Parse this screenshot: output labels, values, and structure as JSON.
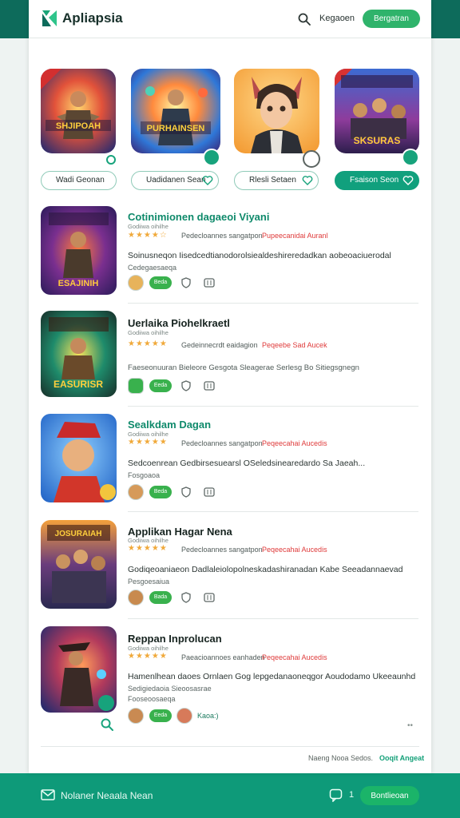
{
  "header": {
    "brand": "Apliapsia",
    "link": "Kegaoen",
    "cta": "Bergatran"
  },
  "featured": [
    {
      "title_art": "SHJIPOAH",
      "button": "Wadi Geonan",
      "active": false
    },
    {
      "title_art": "PURHAINSEN",
      "button": "Uadidanen Sean",
      "active": false
    },
    {
      "title_art": "",
      "button": "Rlesli Setaen",
      "active": false
    },
    {
      "title_art": "SKSURAS",
      "button": "Fsaison Seon",
      "active": true
    }
  ],
  "list": [
    {
      "title": "Cotinimionen dagaeoi Viyani",
      "title_color": "#0f8a6b",
      "subtitle": "Godiiwa oihilhe",
      "stars": "★★★★☆",
      "meta": "Pedecloannes sangatpon",
      "tag": "Pupeecanidai Auranl",
      "desc": "Soinusneqon Iisedcedtianodorolsiealdeshireredadkan aobeoaciuerodal",
      "desc2": "Cedegaesaeqa",
      "pill": "Beda",
      "art": "ESAJINIH"
    },
    {
      "title": "Uerlaika Piohelkraetl",
      "title_color": "#16231f",
      "subtitle": "Godiiwa oihilhe",
      "stars": "★★★★★",
      "meta": "Gedeinnecrdt eaidagion",
      "tag": "Peqeebe Sad Aucek",
      "desc": "Faeseonuuran Bieleore Gesgota Sleagerae Serlesg Bo Sitiegsgnegn",
      "desc2": "",
      "pill": "Eeda",
      "art": "EASURISR"
    },
    {
      "title": "Sealkdam Dagan",
      "title_color": "#0f8a6b",
      "subtitle": "Godiiwa oihilhe",
      "stars": "★★★★★",
      "meta": "Pedecloannes sangatpon",
      "tag": "Peqeecahai Aucedis",
      "desc": "Sedcoenrean Gedbirsesuearsl OSeledsinearedardo Sa Jaeah...",
      "desc2": "Fosgoaoa",
      "pill": "Beda",
      "art": ""
    },
    {
      "title": "Applikan Hagar Nena",
      "title_color": "#16231f",
      "subtitle": "Godiiwa oihilhe",
      "stars": "★★★★★",
      "meta": "Pedecloannes sangatpon",
      "tag": "Peqeecahai Aucedis",
      "desc": "Godiqeoaniaeon Dadlaleiolopolneskadashiranadan Kabe Seeadannaevad",
      "desc2": "Pesgoesaiua",
      "pill": "Bada",
      "art": "JOSURAIAH"
    },
    {
      "title": "Reppan Inprolucan",
      "title_color": "#16231f",
      "subtitle": "Godiiwa oihilhe",
      "stars": "★★★★★",
      "meta": "Paeacioannoes eanhaden",
      "tag": "Peqeecahai Aucedis",
      "desc": "Hamenlhean daoes Ornlaen Gog lepgedanaoneqgor Aoudodamo Ukeeaunhd",
      "desc2": "Sedigiedaoia Sieoosasrae",
      "desc3": "Fooseoosaeqa",
      "pill": "Eeda",
      "extra": "Kaoa:)",
      "art": ""
    }
  ],
  "footer": {
    "note": "Naeng Nooa Sedos.",
    "link": "Ooqit Angeat"
  },
  "bottom_bar": {
    "text": "Nolaner Neaala Nean",
    "count": "1",
    "button": "Bontlieoan"
  },
  "colors": {
    "brand": "#0d6b5b",
    "accent": "#11a07d",
    "cta": "#2fb36b",
    "tag": "#df3b3b",
    "stars": "#f0a93a"
  }
}
